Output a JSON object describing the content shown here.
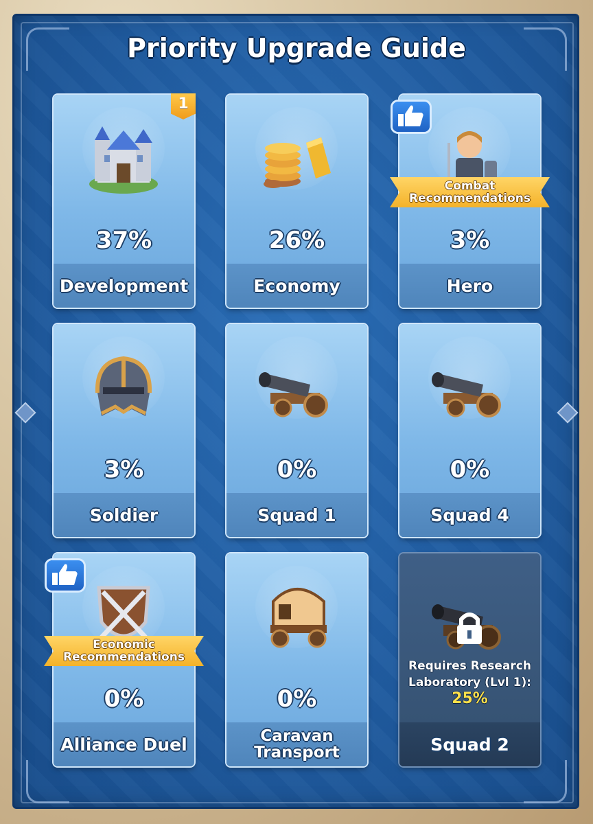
{
  "title": "Priority Upgrade Guide",
  "cards": [
    {
      "pct": "37%",
      "label": "Development",
      "icon": "castle-icon",
      "badge": "1"
    },
    {
      "pct": "26%",
      "label": "Economy",
      "icon": "gold-coins-icon"
    },
    {
      "pct": "3%",
      "label": "Hero",
      "icon": "hero-knight-icon",
      "thumb": "thumbs-up-icon",
      "ribbon": [
        "Combat",
        "Recommendations"
      ]
    },
    {
      "pct": "3%",
      "label": "Soldier",
      "icon": "helmet-icon"
    },
    {
      "pct": "0%",
      "label": "Squad 1",
      "icon": "cannon-icon"
    },
    {
      "pct": "0%",
      "label": "Squad 4",
      "icon": "cannon-icon"
    },
    {
      "pct": "0%",
      "label": "Alliance Duel",
      "icon": "crossed-swords-shield-icon",
      "thumb": "thumbs-up-icon",
      "ribbon": [
        "Economic",
        "Recommendations"
      ]
    },
    {
      "pct": "0%",
      "label": "Caravan Transport",
      "icon": "wagon-icon"
    },
    {
      "label": "Squad 2",
      "icon": "cannon-icon",
      "lock": "padlock-icon",
      "requirement": [
        "Requires Research",
        "Laboratory (Lvl 1):"
      ],
      "req_pct": "25%"
    }
  ],
  "colors": {
    "panel": "#1f5a9e",
    "card": "#7fb8e8",
    "accent": "#ffe04a",
    "badge": "#f4b22a"
  }
}
